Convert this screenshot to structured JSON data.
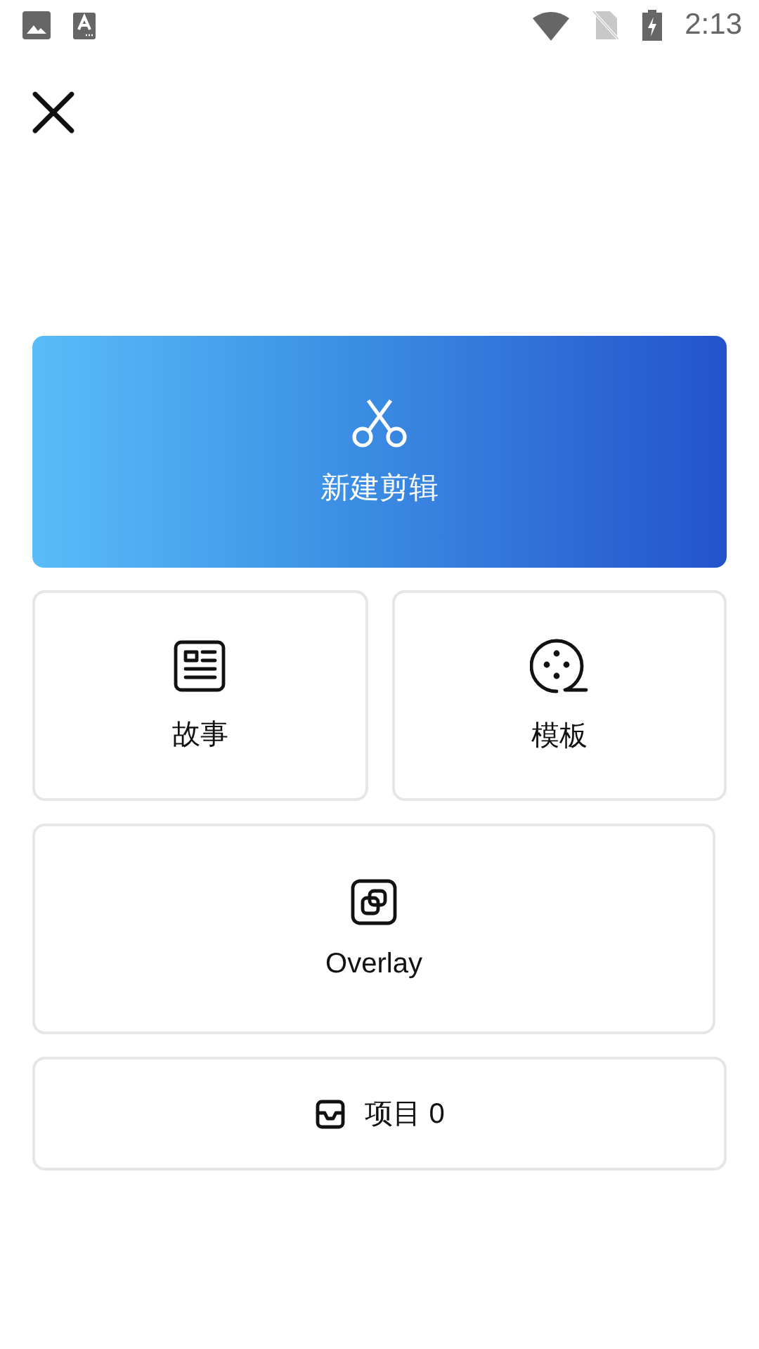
{
  "status_bar": {
    "time": "2:13"
  },
  "new_edit": {
    "label": "新建剪辑"
  },
  "tiles": [
    {
      "kind": "story",
      "label": "故事"
    },
    {
      "kind": "template",
      "label": "模板"
    }
  ],
  "overlay": {
    "label": "Overlay"
  },
  "projects": {
    "label": "项目 0"
  }
}
